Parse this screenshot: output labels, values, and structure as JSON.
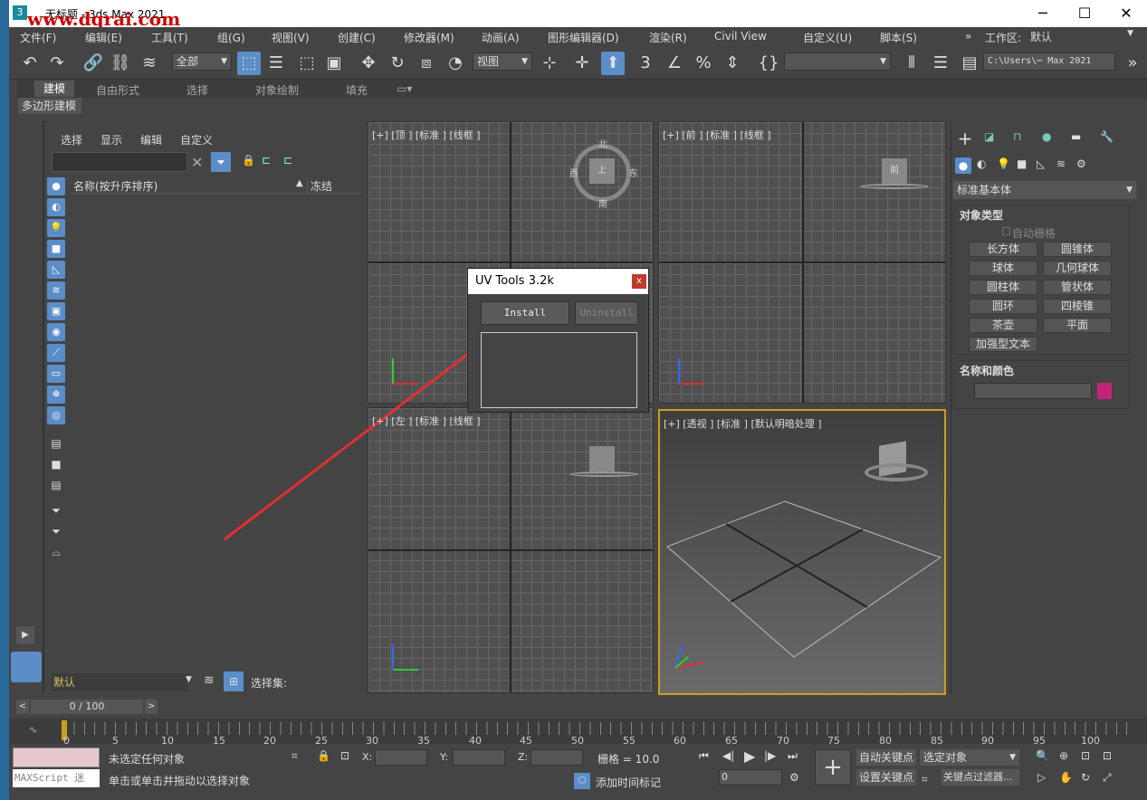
{
  "window": {
    "title": "无标题 - 3ds Max 2021",
    "logo": "3"
  },
  "watermark": "www.dqrai.com",
  "menus": [
    "文件(F)",
    "编辑(E)",
    "工具(T)",
    "组(G)",
    "视图(V)",
    "创建(C)",
    "修改器(M)",
    "动画(A)",
    "图形编辑器(D)",
    "渲染(R)",
    "Civil View",
    "自定义(U)",
    "脚本(S)"
  ],
  "workspace": {
    "label": "工作区:",
    "value": "默认"
  },
  "toolbar": {
    "filter": "全部",
    "refcoord": "视图",
    "path": "C:\\Users\\⋯ Max 2021"
  },
  "ribbon": {
    "tabs": [
      "建模",
      "自由形式",
      "选择",
      "对象绘制",
      "填充"
    ],
    "sub": "多边形建模"
  },
  "scene": {
    "menus": [
      "选择",
      "显示",
      "编辑",
      "自定义"
    ],
    "col_name": "名称(按升序排序)",
    "col_freeze": "冻结",
    "layer": "默认",
    "selset": "选择集:"
  },
  "viewports": {
    "top": "[+] [顶 ] [标准 ] [线框 ]",
    "front": "[+] [前 ] [标准 ] [线框 ]",
    "left": "[+] [左 ] [标准 ] [线框 ]",
    "persp": "[+] [透视 ] [标准 ] [默认明暗处理 ]",
    "cube_top": "上",
    "cube_front": "前",
    "n": "北",
    "s": "南",
    "w": "西",
    "e": "东"
  },
  "dialog": {
    "title": "UV Tools 3.2k",
    "install": "Install",
    "uninstall": "Uninstall"
  },
  "cmd": {
    "category": "标准基本体",
    "rollout1": "对象类型",
    "autogrid": "自动栅格",
    "objects": [
      "长方体",
      "圆锥体",
      "球体",
      "几何球体",
      "圆柱体",
      "管状体",
      "圆环",
      "四棱锥",
      "茶壶",
      "平面",
      "加强型文本"
    ],
    "rollout2": "名称和颜色",
    "color": "#c2247a"
  },
  "time": {
    "frame": "0 / 100",
    "ticks": [
      "0",
      "5",
      "10",
      "15",
      "20",
      "25",
      "30",
      "35",
      "40",
      "45",
      "50",
      "55",
      "60",
      "65",
      "70",
      "75",
      "80",
      "85",
      "90",
      "95",
      "100"
    ]
  },
  "status": {
    "script": "MAXScript 迷",
    "msg1": "未选定任何对象",
    "msg2": "单击或单击并拖动以选择对象",
    "x": "X:",
    "y": "Y:",
    "z": "Z:",
    "grid": "栅格 = 10.0",
    "addtime": "添加时间标记",
    "autokey": "自动关键点",
    "setkey": "设置关键点",
    "selected": "选定对象",
    "filters": "关键点过滤器...",
    "spinner": "0"
  }
}
